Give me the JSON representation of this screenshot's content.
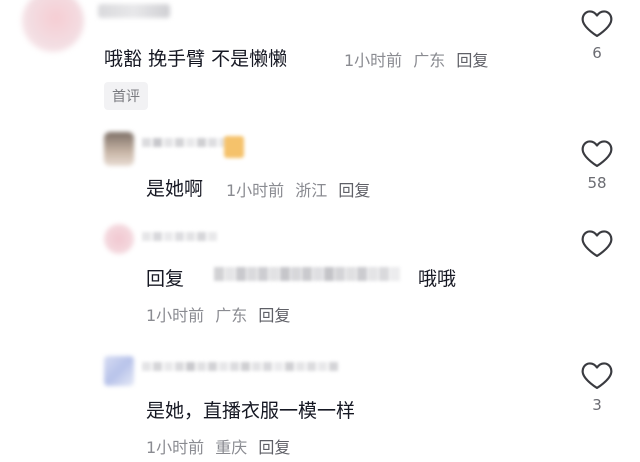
{
  "colors": {
    "text": "#161823",
    "meta": "#8a8b91",
    "heart_stroke": "#3a3b40"
  },
  "icons": {
    "like": "heart-outline-icon"
  },
  "comments": [
    {
      "text": "哦豁 挽手臂 不是懒懒",
      "time": "1小时前",
      "location": "广东",
      "reply": "回复",
      "likes": "6",
      "badge": "首评"
    },
    {
      "text": "是她啊",
      "time": "1小时前",
      "location": "浙江",
      "reply": "回复",
      "likes": "58"
    },
    {
      "prefix": "回复",
      "text": "哦哦",
      "time": "1小时前",
      "location": "广东",
      "reply": "回复",
      "likes": ""
    },
    {
      "text": "是她，直播衣服一模一样",
      "time": "1小时前",
      "location": "重庆",
      "reply": "回复",
      "likes": "3"
    }
  ]
}
